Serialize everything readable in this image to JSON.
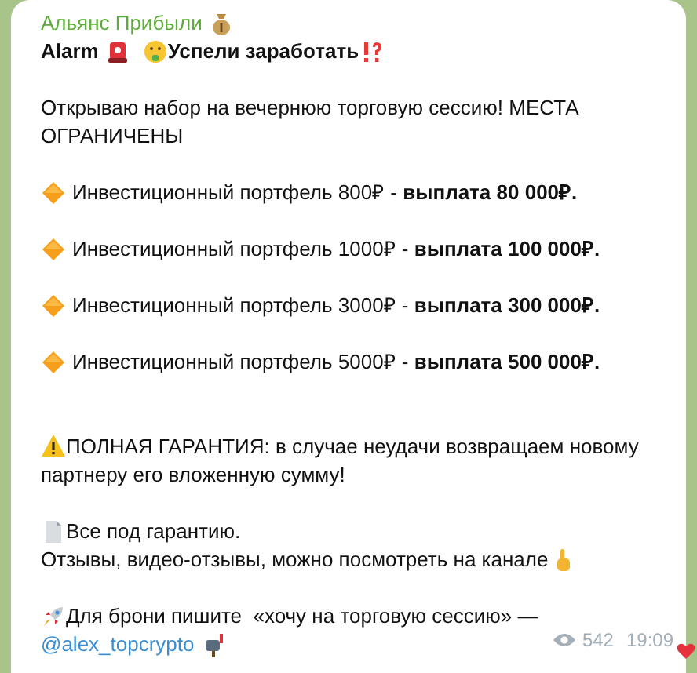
{
  "channel": {
    "name": "Альянс Прибыли"
  },
  "headline": {
    "title": "Alarm",
    "tagline": "Успели заработать"
  },
  "intro": "Открываю набор на вечернюю торговую сессию! МЕСТА ОГРАНИЧЕНЫ",
  "offers": [
    {
      "text": "Инвестиционный портфель 800₽ - **выплата 80 000₽.**"
    },
    {
      "text": "Инвестиционный портфель 1000₽ - **выплата 100 000₽.**"
    },
    {
      "text": "Инвестиционный портфель 3000₽ - **выплата 300 000₽.**"
    },
    {
      "text": "Инвестиционный портфель 5000₽ - **выплата 500 000₽.**"
    }
  ],
  "guarantee": "ПОЛНАЯ ГАРАНТИЯ: в случае неудачи возвращаем новому партнеру его вложенную сумму!",
  "note": {
    "line_1": "Все под гарантию.",
    "line_2": "Отзывы, видео-отзывы, можно посмотреть на канале"
  },
  "cta": {
    "text": "Для брони пишите  «хочу на торговую сессию» —",
    "link": "@alex_topcrypto"
  },
  "meta": {
    "views": "542",
    "time": "19:09"
  }
}
